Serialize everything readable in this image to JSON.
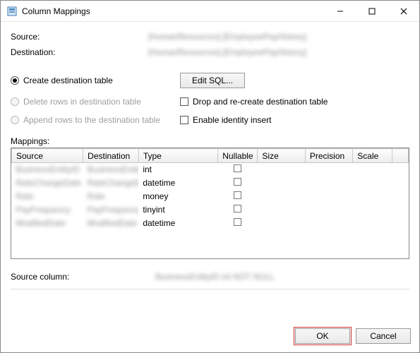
{
  "window": {
    "title": "Column Mappings"
  },
  "fields": {
    "source_label": "Source:",
    "source_value": "[HumanResources].[EmployeePayHistory]",
    "destination_label": "Destination:",
    "destination_value": "[HumanResources].[EmployeePayHistory]"
  },
  "options": {
    "create_table": "Create destination table",
    "edit_sql": "Edit SQL...",
    "delete_rows": "Delete rows in destination table",
    "drop_recreate": "Drop and re-create destination table",
    "append_rows": "Append rows to the destination table",
    "identity_insert": "Enable identity insert"
  },
  "mappings_label": "Mappings:",
  "grid": {
    "headers": {
      "source": "Source",
      "destination": "Destination",
      "type": "Type",
      "nullable": "Nullable",
      "size": "Size",
      "precision": "Precision",
      "scale": "Scale"
    },
    "rows": [
      {
        "source": "BusinessEntityID",
        "destination": "BusinessEntityID",
        "type": "int"
      },
      {
        "source": "RateChangeDate",
        "destination": "RateChangeDate",
        "type": "datetime"
      },
      {
        "source": "Rate",
        "destination": "Rate",
        "type": "money"
      },
      {
        "source": "PayFrequency",
        "destination": "PayFrequency",
        "type": "tinyint"
      },
      {
        "source": "ModifiedDate",
        "destination": "ModifiedDate",
        "type": "datetime"
      }
    ]
  },
  "footer": {
    "label": "Source column:",
    "value": "BusinessEntityID int NOT NULL"
  },
  "buttons": {
    "ok": "OK",
    "cancel": "Cancel"
  }
}
